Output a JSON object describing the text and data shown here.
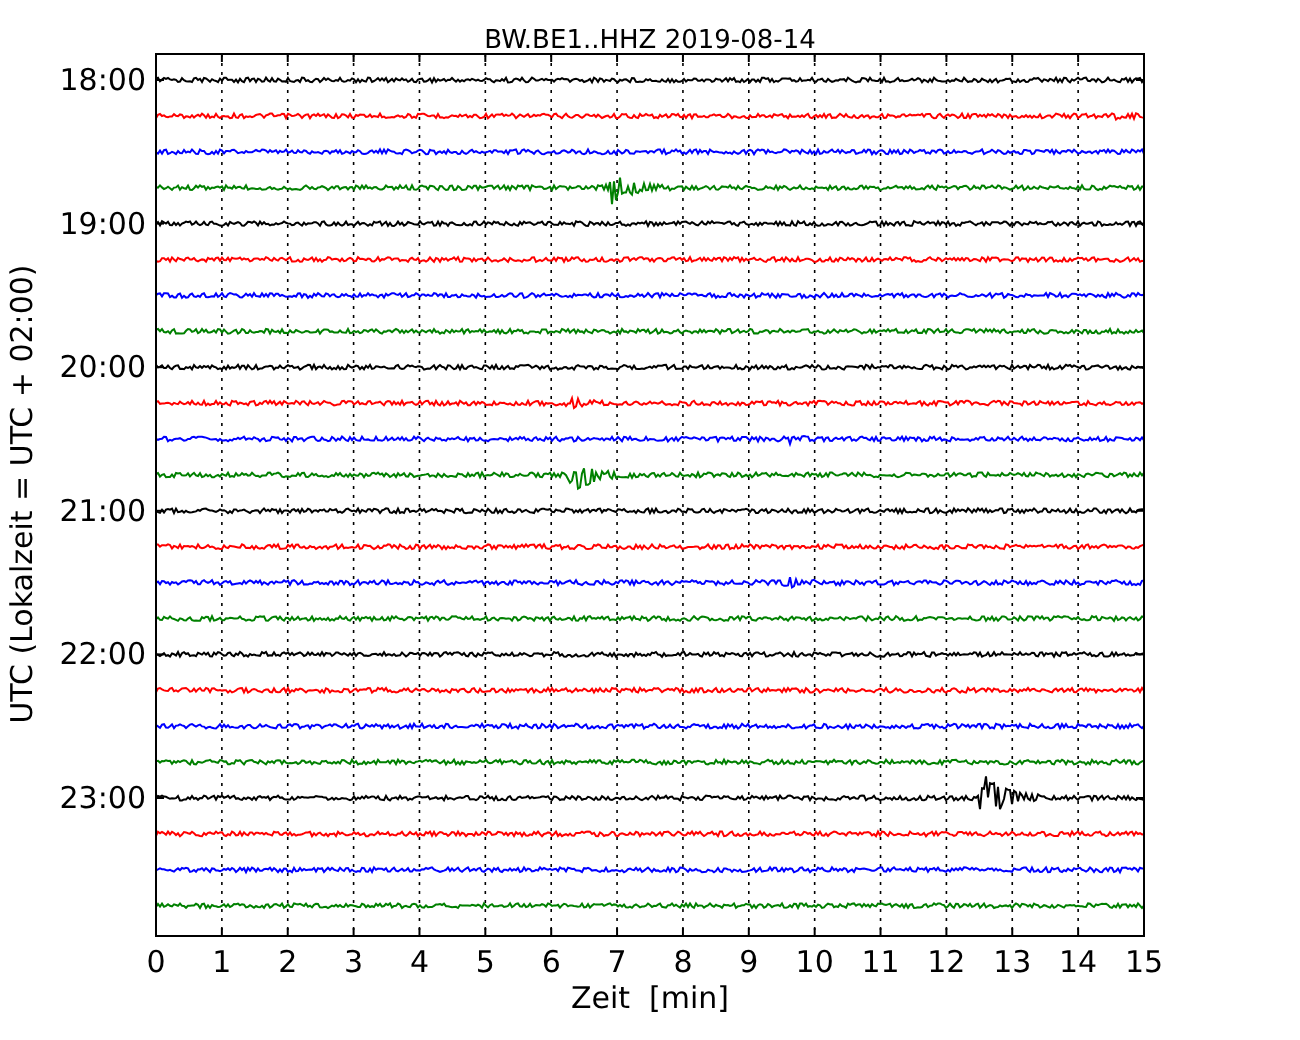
{
  "title": "BW.BE1..HHZ 2019-08-14",
  "ylabel": "UTC (Lokalzeit = UTC + 02:00)",
  "xlabel": "Zeit  [min]",
  "xticks": [
    "0",
    "1",
    "2",
    "3",
    "4",
    "5",
    "6",
    "7",
    "8",
    "9",
    "10",
    "11",
    "12",
    "13",
    "14",
    "15"
  ],
  "yticks": [
    "18:00",
    "19:00",
    "20:00",
    "21:00",
    "22:00",
    "23:00"
  ],
  "traces": [
    {
      "color": "#000000"
    },
    {
      "color": "#ff0000"
    },
    {
      "color": "#0000ff"
    },
    {
      "color": "#008000"
    },
    {
      "color": "#000000"
    },
    {
      "color": "#ff0000"
    },
    {
      "color": "#0000ff"
    },
    {
      "color": "#008000"
    },
    {
      "color": "#000000"
    },
    {
      "color": "#ff0000"
    },
    {
      "color": "#0000ff"
    },
    {
      "color": "#008000"
    },
    {
      "color": "#000000"
    },
    {
      "color": "#ff0000"
    },
    {
      "color": "#0000ff"
    },
    {
      "color": "#008000"
    },
    {
      "color": "#000000"
    },
    {
      "color": "#ff0000"
    },
    {
      "color": "#0000ff"
    },
    {
      "color": "#008000"
    },
    {
      "color": "#000000"
    },
    {
      "color": "#ff0000"
    },
    {
      "color": "#0000ff"
    },
    {
      "color": "#008000"
    }
  ]
}
